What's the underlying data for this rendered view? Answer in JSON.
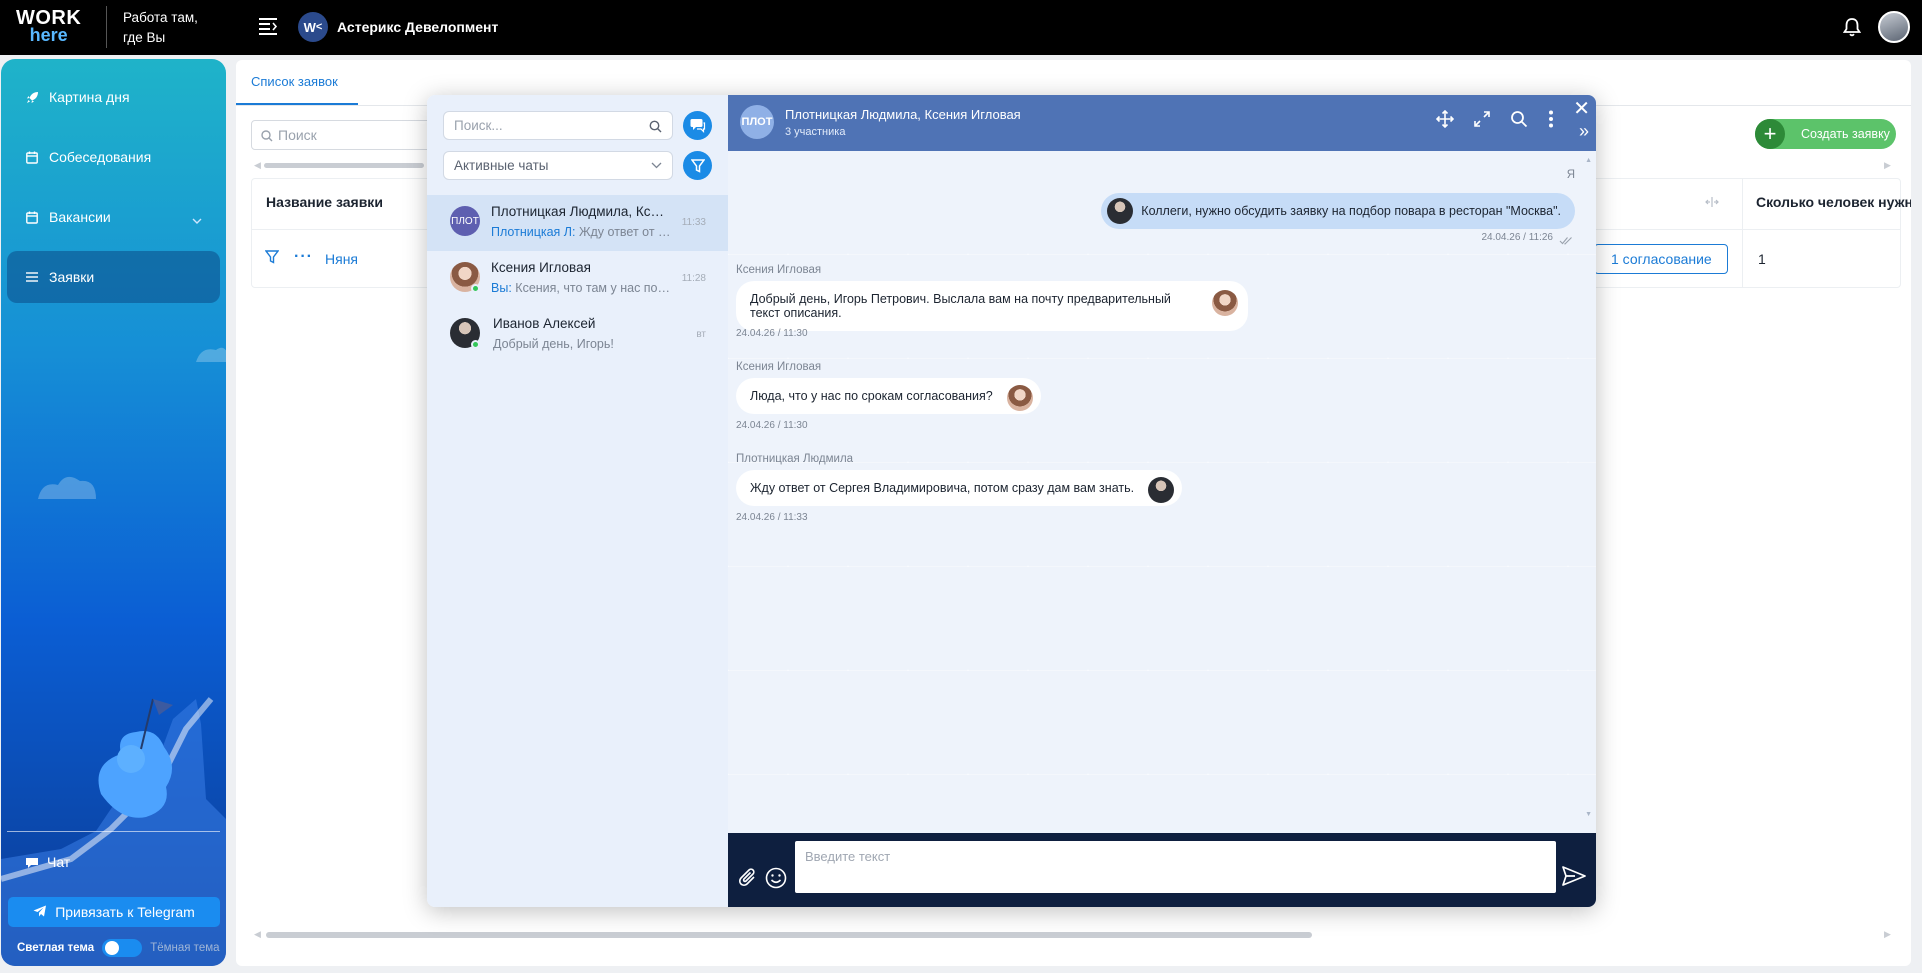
{
  "header": {
    "logo_top": "WORK",
    "logo_bottom": "here",
    "tagline_1": "Работа там,",
    "tagline_2": "где Вы",
    "company_badge": "W",
    "company_name": "Астерикс Девелопмент",
    "icons": [
      "menu-icon",
      "bell-icon",
      "user-avatar"
    ]
  },
  "sidebar": {
    "items": [
      {
        "label": "Картина дня",
        "icon": "rocket-icon"
      },
      {
        "label": "Собеседования",
        "icon": "calendar-icon"
      },
      {
        "label": "Вакансии",
        "icon": "calendar-icon",
        "expandable": true
      },
      {
        "label": "Заявки",
        "icon": "list-icon",
        "active": true
      }
    ],
    "chat_label": "Чат",
    "telegram_button": "Привязать к Telegram",
    "theme_light": "Светлая тема",
    "theme_dark": "Тёмная тема"
  },
  "main": {
    "tab": "Список заявок",
    "search_placeholder": "Поиск",
    "create_button": "Создать заявку",
    "columns": {
      "name": "Название заявки",
      "count": "Сколько человек нужно"
    },
    "row": {
      "name": "Няня",
      "status_button": "1 согласование",
      "count": "1"
    }
  },
  "chat_list": {
    "search_placeholder": "Поиск...",
    "filter_value": "Активные чаты",
    "items": [
      {
        "avatar": "ПЛОТ",
        "name": "Плотницкая Людмила, Ксения Игловая",
        "prefix": "Плотницкая Л:",
        "preview": "Жду ответ от Сергея Владимировича",
        "time": "11:33",
        "active": true
      },
      {
        "name": "Ксения Игловая",
        "prefix": "Вы:",
        "preview": "Ксения, что там у нас по срокам",
        "time": "11:28",
        "online": true
      },
      {
        "name": "Иванов Алексей",
        "prefix": "",
        "preview": "Добрый день, Игорь!",
        "time": "вт",
        "online": true
      }
    ]
  },
  "conversation": {
    "avatar": "ПЛОТ",
    "title": "Плотницкая Людмила, Ксения Игловая",
    "subtitle": "3 участника",
    "me_label": "Я",
    "messages": [
      {
        "text": "Коллеги, нужно обсудить заявку на подбор повара в ресторан \"Москва\".",
        "time": "24.04.26 / 11:26"
      },
      {
        "sender": "Ксения Игловая",
        "text": "Добрый день, Игорь Петрович. Выслала вам на почту предварительный текст описания.",
        "time": "24.04.26 / 11:30"
      },
      {
        "sender": "Ксения Игловая",
        "text": "Люда, что у нас по срокам согласования?",
        "time": "24.04.26 / 11:30"
      },
      {
        "sender": "Плотницкая Людмила",
        "text": "Жду ответ от Сергея Владимировича, потом сразу дам вам знать.",
        "time": "24.04.26 / 11:33"
      }
    ],
    "input_placeholder": "Введите текст"
  },
  "colors": {
    "topbar": "#000000",
    "accent": "#1b7bd6",
    "chat_header": "#4f73b5",
    "create_button": "#5cc36a"
  }
}
